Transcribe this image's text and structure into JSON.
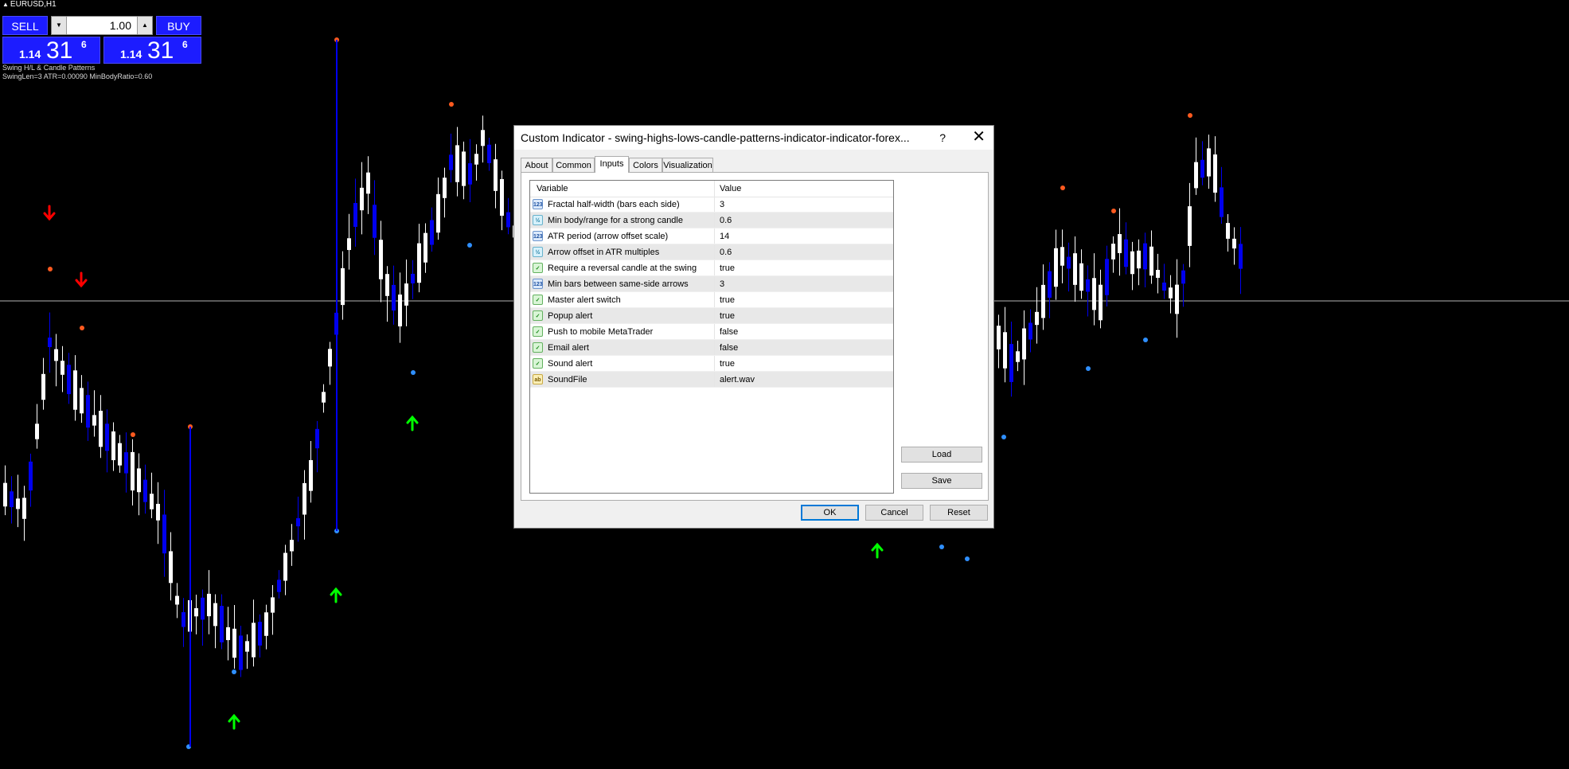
{
  "chart": {
    "symbol_label": "EURUSD,H1",
    "indicator_name": "Swing H/L & Candle Patterns",
    "indicator_params": "SwingLen=3  ATR=0.00090  MinBodyRatio=0.60",
    "colors": {
      "background": "#000000",
      "bull_candle": "#ffffff",
      "bear_candle": "#0000ee",
      "swing_high_dot": "#ff5a1f",
      "swing_low_dot": "#2f8fff",
      "sell_arrow": "#ff0000",
      "buy_arrow": "#00ff00",
      "price_line": "#b4b4b4"
    }
  },
  "trade_panel": {
    "sell_label": "SELL",
    "buy_label": "BUY",
    "lot_value": "1.00",
    "sell_price": {
      "prefix": "1.14",
      "big": "31",
      "sup": "6"
    },
    "buy_price": {
      "prefix": "1.14",
      "big": "31",
      "sup": "6"
    }
  },
  "dialog": {
    "title": "Custom Indicator - swing-highs-lows-candle-patterns-indicator-indicator-forex...",
    "help_label": "?",
    "close_label": "✕",
    "tabs": [
      "About",
      "Common",
      "Inputs",
      "Colors",
      "Visualization"
    ],
    "active_tab": "Inputs",
    "columns": {
      "variable": "Variable",
      "value": "Value"
    },
    "inputs": [
      {
        "icon": "123",
        "type": "int",
        "variable": "Fractal half-width (bars each side)",
        "value": "3"
      },
      {
        "icon": "½",
        "type": "double",
        "variable": "Min body/range for a strong candle",
        "value": "0.6"
      },
      {
        "icon": "123",
        "type": "int",
        "variable": "ATR period (arrow offset scale)",
        "value": "14"
      },
      {
        "icon": "½",
        "type": "double",
        "variable": "Arrow offset in ATR multiples",
        "value": "0.6"
      },
      {
        "icon": "✓",
        "type": "bool",
        "variable": "Require a reversal candle at the swing",
        "value": "true"
      },
      {
        "icon": "123",
        "type": "int",
        "variable": "Min bars between same-side arrows",
        "value": "3"
      },
      {
        "icon": "✓",
        "type": "bool",
        "variable": "Master alert switch",
        "value": "true"
      },
      {
        "icon": "✓",
        "type": "bool",
        "variable": "Popup alert",
        "value": "true"
      },
      {
        "icon": "✓",
        "type": "bool",
        "variable": "Push to mobile MetaTrader",
        "value": "false"
      },
      {
        "icon": "✓",
        "type": "bool",
        "variable": "Email alert",
        "value": "false"
      },
      {
        "icon": "✓",
        "type": "bool",
        "variable": "Sound alert",
        "value": "true"
      },
      {
        "icon": "ab",
        "type": "string",
        "variable": "SoundFile",
        "value": "alert.wav"
      }
    ],
    "buttons": {
      "load": "Load",
      "save": "Save",
      "ok": "OK",
      "cancel": "Cancel",
      "reset": "Reset"
    }
  }
}
